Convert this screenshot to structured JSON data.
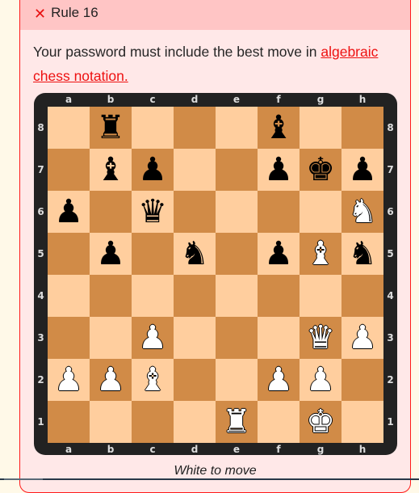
{
  "rule": {
    "status_icon": "x-icon",
    "status_icon_glyph": "✕",
    "title": "Rule 16",
    "description_prefix": "Your password must include the best move in ",
    "link_text": "algebraic chess notation.",
    "caption": "White to move"
  },
  "colors": {
    "light_square": "#ffce9e",
    "dark_square": "#d18b47",
    "frame": "#222222",
    "accent": "#ee1111"
  },
  "board": {
    "files": [
      "a",
      "b",
      "c",
      "d",
      "e",
      "f",
      "g",
      "h"
    ],
    "ranks": [
      "8",
      "7",
      "6",
      "5",
      "4",
      "3",
      "2",
      "1"
    ],
    "side_to_move": "white",
    "pieces": [
      {
        "square": "b8",
        "color": "black",
        "type": "rook"
      },
      {
        "square": "f8",
        "color": "black",
        "type": "bishop"
      },
      {
        "square": "b7",
        "color": "black",
        "type": "bishop"
      },
      {
        "square": "c7",
        "color": "black",
        "type": "pawn"
      },
      {
        "square": "f7",
        "color": "black",
        "type": "pawn"
      },
      {
        "square": "g7",
        "color": "black",
        "type": "king"
      },
      {
        "square": "h7",
        "color": "black",
        "type": "pawn"
      },
      {
        "square": "a6",
        "color": "black",
        "type": "pawn"
      },
      {
        "square": "c6",
        "color": "black",
        "type": "queen"
      },
      {
        "square": "h6",
        "color": "white",
        "type": "knight"
      },
      {
        "square": "b5",
        "color": "black",
        "type": "pawn"
      },
      {
        "square": "d5",
        "color": "black",
        "type": "knight"
      },
      {
        "square": "f5",
        "color": "black",
        "type": "pawn"
      },
      {
        "square": "g5",
        "color": "white",
        "type": "bishop"
      },
      {
        "square": "h5",
        "color": "black",
        "type": "knight"
      },
      {
        "square": "c3",
        "color": "white",
        "type": "pawn"
      },
      {
        "square": "g3",
        "color": "white",
        "type": "queen"
      },
      {
        "square": "h3",
        "color": "white",
        "type": "pawn"
      },
      {
        "square": "a2",
        "color": "white",
        "type": "pawn"
      },
      {
        "square": "b2",
        "color": "white",
        "type": "pawn"
      },
      {
        "square": "c2",
        "color": "white",
        "type": "bishop"
      },
      {
        "square": "f2",
        "color": "white",
        "type": "pawn"
      },
      {
        "square": "g2",
        "color": "white",
        "type": "pawn"
      },
      {
        "square": "e1",
        "color": "white",
        "type": "rook"
      },
      {
        "square": "g1",
        "color": "white",
        "type": "king"
      }
    ]
  }
}
